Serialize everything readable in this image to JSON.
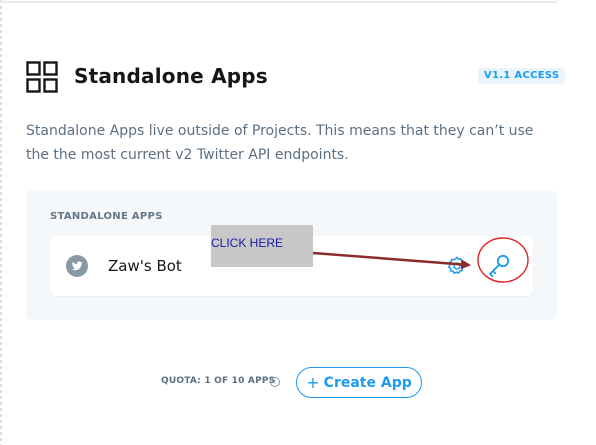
{
  "section": {
    "title": "Standalone Apps",
    "badge": "V1.1 ACCESS",
    "description": "Standalone Apps live outside of Projects. This means that they can’t use the the most current v2 Twitter API endpoints.",
    "icon": "grid-icon"
  },
  "apps_panel": {
    "label": "STANDALONE APPS",
    "apps": [
      {
        "name": "Zaw's Bot",
        "platform_icon": "twitter-icon",
        "actions": [
          "settings-icon",
          "keys-icon"
        ]
      }
    ]
  },
  "annotation": {
    "text": "CLICK HERE",
    "color": "#8b2c2c"
  },
  "footer": {
    "quota": "QUOTA: 1 OF 10 APPS",
    "info_glyph": "i",
    "create_app_plus": "+",
    "create_app_label": "Create App"
  },
  "colors": {
    "accent": "#1d9bf0",
    "text_primary": "#14171a",
    "text_secondary": "#5b7083",
    "panel_bg": "#f5f8fa",
    "annotation_circle": "#e0242a"
  }
}
